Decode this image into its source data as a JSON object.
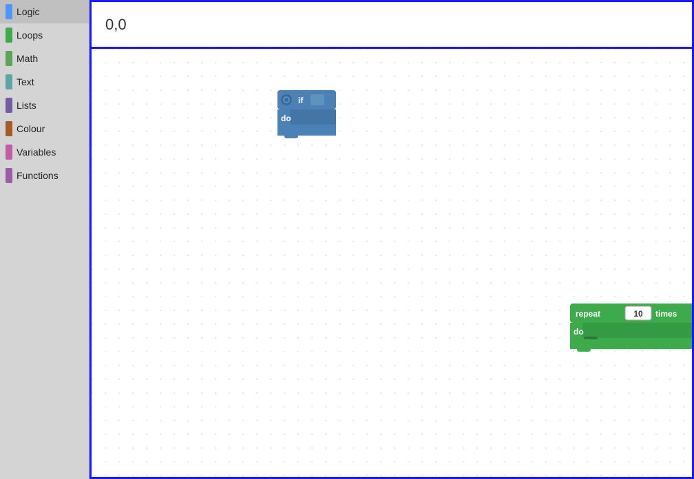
{
  "sidebar": {
    "items": [
      {
        "id": "logic",
        "label": "Logic",
        "color": "#4C97FF"
      },
      {
        "id": "loops",
        "label": "Loops",
        "color": "#3DAA4C"
      },
      {
        "id": "math",
        "label": "Math",
        "color": "#5BA55B"
      },
      {
        "id": "text",
        "label": "Text",
        "color": "#5BA5A5"
      },
      {
        "id": "lists",
        "label": "Lists",
        "color": "#745CA5"
      },
      {
        "id": "colour",
        "label": "Colour",
        "color": "#A55B26"
      },
      {
        "id": "variables",
        "label": "Variables",
        "color": "#C45BA5"
      },
      {
        "id": "functions",
        "label": "Functions",
        "color": "#9A5CA6"
      }
    ]
  },
  "coords": "0,0",
  "blocks": {
    "if_block": {
      "label_if": "if",
      "label_do": "do"
    },
    "repeat_block": {
      "label_repeat": "repeat",
      "value": "10",
      "label_times": "times",
      "label_do": "do"
    }
  }
}
